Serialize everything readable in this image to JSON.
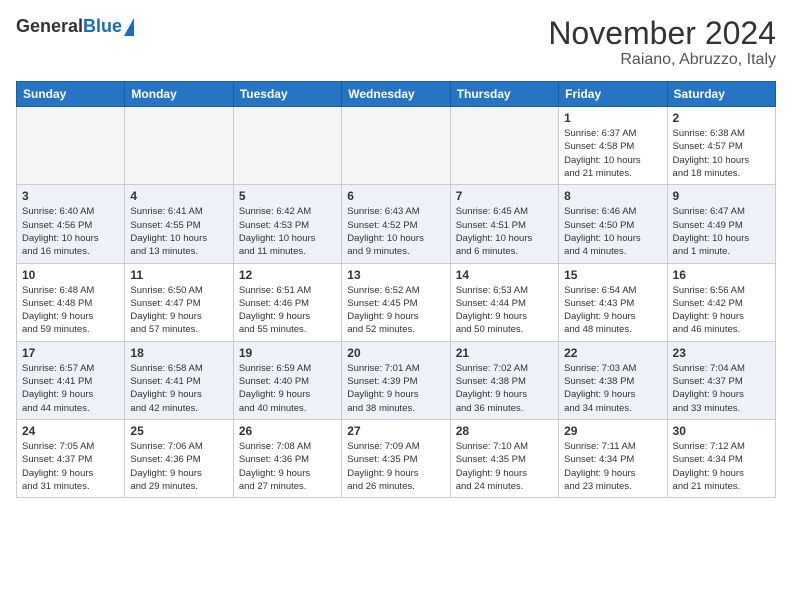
{
  "header": {
    "logo_general": "General",
    "logo_blue": "Blue",
    "title": "November 2024",
    "subtitle": "Raiano, Abruzzo, Italy"
  },
  "weekdays": [
    "Sunday",
    "Monday",
    "Tuesday",
    "Wednesday",
    "Thursday",
    "Friday",
    "Saturday"
  ],
  "weeks": [
    [
      {
        "day": "",
        "info": ""
      },
      {
        "day": "",
        "info": ""
      },
      {
        "day": "",
        "info": ""
      },
      {
        "day": "",
        "info": ""
      },
      {
        "day": "",
        "info": ""
      },
      {
        "day": "1",
        "info": "Sunrise: 6:37 AM\nSunset: 4:58 PM\nDaylight: 10 hours\nand 21 minutes."
      },
      {
        "day": "2",
        "info": "Sunrise: 6:38 AM\nSunset: 4:57 PM\nDaylight: 10 hours\nand 18 minutes."
      }
    ],
    [
      {
        "day": "3",
        "info": "Sunrise: 6:40 AM\nSunset: 4:56 PM\nDaylight: 10 hours\nand 16 minutes."
      },
      {
        "day": "4",
        "info": "Sunrise: 6:41 AM\nSunset: 4:55 PM\nDaylight: 10 hours\nand 13 minutes."
      },
      {
        "day": "5",
        "info": "Sunrise: 6:42 AM\nSunset: 4:53 PM\nDaylight: 10 hours\nand 11 minutes."
      },
      {
        "day": "6",
        "info": "Sunrise: 6:43 AM\nSunset: 4:52 PM\nDaylight: 10 hours\nand 9 minutes."
      },
      {
        "day": "7",
        "info": "Sunrise: 6:45 AM\nSunset: 4:51 PM\nDaylight: 10 hours\nand 6 minutes."
      },
      {
        "day": "8",
        "info": "Sunrise: 6:46 AM\nSunset: 4:50 PM\nDaylight: 10 hours\nand 4 minutes."
      },
      {
        "day": "9",
        "info": "Sunrise: 6:47 AM\nSunset: 4:49 PM\nDaylight: 10 hours\nand 1 minute."
      }
    ],
    [
      {
        "day": "10",
        "info": "Sunrise: 6:48 AM\nSunset: 4:48 PM\nDaylight: 9 hours\nand 59 minutes."
      },
      {
        "day": "11",
        "info": "Sunrise: 6:50 AM\nSunset: 4:47 PM\nDaylight: 9 hours\nand 57 minutes."
      },
      {
        "day": "12",
        "info": "Sunrise: 6:51 AM\nSunset: 4:46 PM\nDaylight: 9 hours\nand 55 minutes."
      },
      {
        "day": "13",
        "info": "Sunrise: 6:52 AM\nSunset: 4:45 PM\nDaylight: 9 hours\nand 52 minutes."
      },
      {
        "day": "14",
        "info": "Sunrise: 6:53 AM\nSunset: 4:44 PM\nDaylight: 9 hours\nand 50 minutes."
      },
      {
        "day": "15",
        "info": "Sunrise: 6:54 AM\nSunset: 4:43 PM\nDaylight: 9 hours\nand 48 minutes."
      },
      {
        "day": "16",
        "info": "Sunrise: 6:56 AM\nSunset: 4:42 PM\nDaylight: 9 hours\nand 46 minutes."
      }
    ],
    [
      {
        "day": "17",
        "info": "Sunrise: 6:57 AM\nSunset: 4:41 PM\nDaylight: 9 hours\nand 44 minutes."
      },
      {
        "day": "18",
        "info": "Sunrise: 6:58 AM\nSunset: 4:41 PM\nDaylight: 9 hours\nand 42 minutes."
      },
      {
        "day": "19",
        "info": "Sunrise: 6:59 AM\nSunset: 4:40 PM\nDaylight: 9 hours\nand 40 minutes."
      },
      {
        "day": "20",
        "info": "Sunrise: 7:01 AM\nSunset: 4:39 PM\nDaylight: 9 hours\nand 38 minutes."
      },
      {
        "day": "21",
        "info": "Sunrise: 7:02 AM\nSunset: 4:38 PM\nDaylight: 9 hours\nand 36 minutes."
      },
      {
        "day": "22",
        "info": "Sunrise: 7:03 AM\nSunset: 4:38 PM\nDaylight: 9 hours\nand 34 minutes."
      },
      {
        "day": "23",
        "info": "Sunrise: 7:04 AM\nSunset: 4:37 PM\nDaylight: 9 hours\nand 33 minutes."
      }
    ],
    [
      {
        "day": "24",
        "info": "Sunrise: 7:05 AM\nSunset: 4:37 PM\nDaylight: 9 hours\nand 31 minutes."
      },
      {
        "day": "25",
        "info": "Sunrise: 7:06 AM\nSunset: 4:36 PM\nDaylight: 9 hours\nand 29 minutes."
      },
      {
        "day": "26",
        "info": "Sunrise: 7:08 AM\nSunset: 4:36 PM\nDaylight: 9 hours\nand 27 minutes."
      },
      {
        "day": "27",
        "info": "Sunrise: 7:09 AM\nSunset: 4:35 PM\nDaylight: 9 hours\nand 26 minutes."
      },
      {
        "day": "28",
        "info": "Sunrise: 7:10 AM\nSunset: 4:35 PM\nDaylight: 9 hours\nand 24 minutes."
      },
      {
        "day": "29",
        "info": "Sunrise: 7:11 AM\nSunset: 4:34 PM\nDaylight: 9 hours\nand 23 minutes."
      },
      {
        "day": "30",
        "info": "Sunrise: 7:12 AM\nSunset: 4:34 PM\nDaylight: 9 hours\nand 21 minutes."
      }
    ]
  ]
}
